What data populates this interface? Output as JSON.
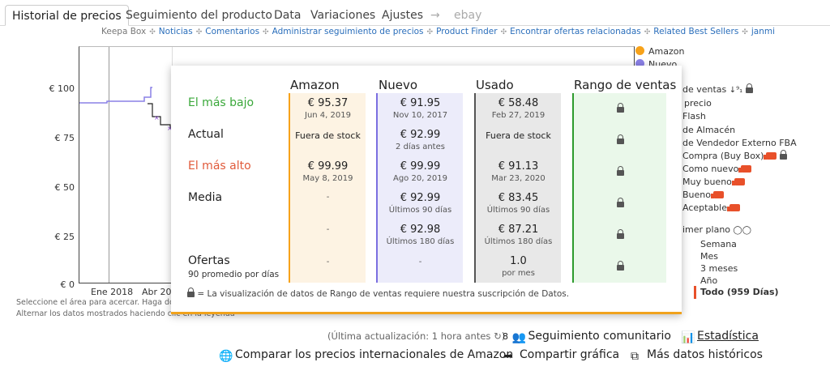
{
  "tabs": [
    {
      "label": "Historial de precios",
      "active": true
    },
    {
      "label": "Seguimiento del producto"
    },
    {
      "label": "Data"
    },
    {
      "label": "Variaciones"
    },
    {
      "label": "Ajustes"
    },
    {
      "label": "→"
    },
    {
      "label": "ebay"
    }
  ],
  "links": {
    "prefix": "Keepa Box",
    "items": [
      "Noticias",
      "Comentarios",
      "Administrar seguimiento de precios",
      "Product Finder",
      "Encontrar ofertas relacionadas",
      "Related Best Sellers",
      "janmi"
    ]
  },
  "chart": {
    "y_ticks": [
      "€ 100",
      "€ 75",
      "€ 50",
      "€ 25",
      "€ 0"
    ],
    "x_ticks": [
      "Ene 2018",
      "Abr 201"
    ],
    "hint_1": "Seleccione el área para acercar. Haga dobl",
    "hint_2": "Alternar los datos mostrados haciendo clic en la leyenda"
  },
  "legend": {
    "amazon": "Amazon",
    "nuevo": "Nuevo",
    "rows": [
      "de ventas",
      "precio",
      "Flash",
      "de Almacén",
      "de Vendedor Externo FBA",
      "Compra (Buy Box)",
      "Como nuevo",
      "Muy bueno",
      "Bueno",
      "Aceptable"
    ],
    "plano": "imer plano",
    "ranges": [
      "Semana",
      "Mes",
      "3 meses",
      "Año"
    ],
    "selected_range": "Todo (959 Días)",
    "colors": {
      "amazon": "#f7a21a",
      "nuevo": "#8a80e6",
      "truck": "#e8502a"
    }
  },
  "popup": {
    "headers": [
      "Amazon",
      "Nuevo",
      "Usado",
      "Rango de ventas"
    ],
    "labels": {
      "lowest": "El más bajo",
      "current": "Actual",
      "highest": "El más alto",
      "average": "Media",
      "offers": "Ofertas",
      "offers_sub": "90 promedio por días"
    },
    "amazon": {
      "low_v": "€ 95.37",
      "low_d": "Jun 4, 2019",
      "cur": "Fuera de stock",
      "high_v": "€ 99.99",
      "high_d": "May 8, 2019",
      "avg90": "-",
      "avg180": "-",
      "offers": "-"
    },
    "nuevo": {
      "low_v": "€ 91.95",
      "low_d": "Nov 10, 2017",
      "cur_v": "€ 92.99",
      "cur_d": "2 días antes",
      "high_v": "€ 99.99",
      "high_d": "Ago 20, 2019",
      "avg90_v": "€ 92.99",
      "avg90_d": "Últimos 90 días",
      "avg180_v": "€ 92.98",
      "avg180_d": "Últimos 180 días",
      "offers": "-"
    },
    "usado": {
      "low_v": "€ 58.48",
      "low_d": "Feb 27, 2019",
      "cur": "Fuera de stock",
      "high_v": "€ 91.13",
      "high_d": "Mar 23, 2020",
      "avg90_v": "€ 83.45",
      "avg90_d": "Últimos 90 días",
      "avg180_v": "€ 87.21",
      "avg180_d": "Últimos 180 días",
      "offers_v": "1.0",
      "offers_d": "por mes"
    },
    "footnote": "= La visualización de datos de Rango de ventas requiere nuestra suscripción de Datos."
  },
  "bottom": {
    "updated": "(Última actualización: 1 hora antes",
    "community_count": "8",
    "community": "Seguimiento comunitario",
    "stats": "Estadística",
    "compare": "Comparar los precios internacionales de Amazon",
    "share": "Compartir gráfica",
    "more": "Más datos históricos"
  }
}
